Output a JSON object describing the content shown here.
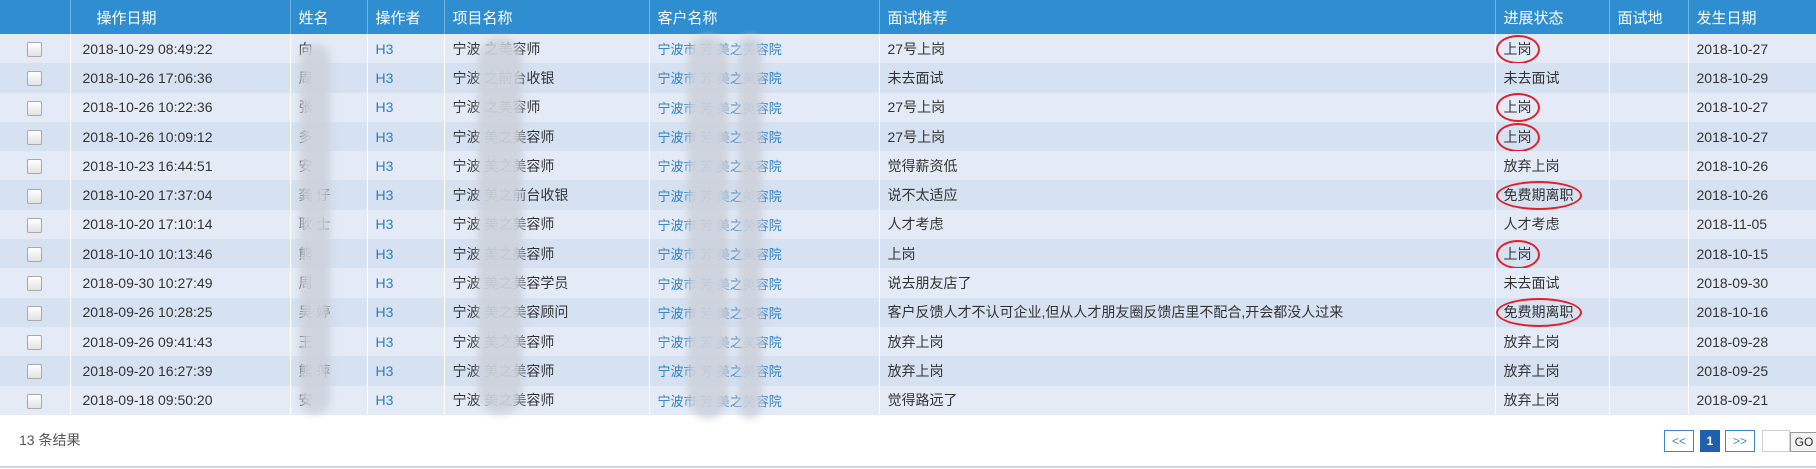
{
  "columns": [
    "",
    "操作日期",
    "姓名",
    "操作者",
    "项目名称",
    "客户名称",
    "面试推荐",
    "进展状态",
    "面试地",
    "发生日期"
  ],
  "rows": [
    {
      "date": "2018-10-29 08:49:22",
      "name": "向",
      "operator": "H3",
      "project": "宁波   之美容师",
      "customer": "宁波市  芳  美之美容院",
      "remark": "27号上岗",
      "status": "上岗",
      "circled": true,
      "place": "",
      "occur": "2018-10-27"
    },
    {
      "date": "2018-10-26 17:06:36",
      "name": "周",
      "operator": "H3",
      "project": "宁波   之前台收银",
      "customer": "宁波市  芳  美之美容院",
      "remark": "未去面试",
      "status": "未去面试",
      "circled": false,
      "place": "",
      "occur": "2018-10-29"
    },
    {
      "date": "2018-10-26 10:22:36",
      "name": "张  ",
      "operator": "H3",
      "project": "宁波   之美容师",
      "customer": "宁波市  芳  美之美容院",
      "remark": "27号上岗",
      "status": "上岗",
      "circled": true,
      "place": "",
      "occur": "2018-10-27"
    },
    {
      "date": "2018-10-26 10:09:12",
      "name": "多",
      "operator": "H3",
      "project": "宁波   美之美容师",
      "customer": "宁波市  芳  美之美容院",
      "remark": "27号上岗",
      "status": "上岗",
      "circled": true,
      "place": "",
      "occur": "2018-10-27"
    },
    {
      "date": "2018-10-23 16:44:51",
      "name": "安",
      "operator": "H3",
      "project": "宁波   美之美容师",
      "customer": "宁波市  芳  美之美容院",
      "remark": "觉得薪资低",
      "status": "放弃上岗",
      "circled": false,
      "place": "",
      "occur": "2018-10-26"
    },
    {
      "date": "2018-10-20 17:37:04",
      "name": "龚  仔",
      "operator": "H3",
      "project": "宁波   美之前台收银",
      "customer": "宁波市  芳  美之美容院",
      "remark": "说不太适应",
      "status": "免费期离职",
      "circled": true,
      "place": "",
      "occur": "2018-10-26"
    },
    {
      "date": "2018-10-20 17:10:14",
      "name": "耿  士",
      "operator": "H3",
      "project": "宁波   美之美容师",
      "customer": "宁波市  芳  美之美容院",
      "remark": "人才考虑",
      "status": "人才考虑",
      "circled": false,
      "place": "",
      "occur": "2018-11-05"
    },
    {
      "date": "2018-10-10 10:13:46",
      "name": "熊",
      "operator": "H3",
      "project": "宁波   美之美容师",
      "customer": "宁波市  芳  美之美容院",
      "remark": "上岗",
      "status": "上岗",
      "circled": true,
      "place": "",
      "occur": "2018-10-15"
    },
    {
      "date": "2018-09-30 10:27:49",
      "name": "周",
      "operator": "H3",
      "project": "宁波   美之美容学员",
      "customer": "宁波市  芳  美之美容院",
      "remark": "说去朋友店了",
      "status": "未去面试",
      "circled": false,
      "place": "",
      "occur": "2018-09-30"
    },
    {
      "date": "2018-09-26 10:28:25",
      "name": "吴  婷",
      "operator": "H3",
      "project": "宁波   美之美容顾问",
      "customer": "宁波市  芳  美之美容院",
      "remark": "客户反馈人才不认可企业,但从人才朋友圈反馈店里不配合,开会都没人过来",
      "status": "免费期离职",
      "circled": true,
      "place": "",
      "occur": "2018-10-16"
    },
    {
      "date": "2018-09-26 09:41:43",
      "name": "王",
      "operator": "H3",
      "project": "宁波   美之美容师",
      "customer": "宁波市  芳  美之美容院",
      "remark": "放弃上岗",
      "status": "放弃上岗",
      "circled": false,
      "place": "",
      "occur": "2018-09-28"
    },
    {
      "date": "2018-09-20 16:27:39",
      "name": "熊  萍",
      "operator": "H3",
      "project": "宁波   美之美容师",
      "customer": "宁波市  芳  美之美容院",
      "remark": "放弃上岗",
      "status": "放弃上岗",
      "circled": false,
      "place": "",
      "occur": "2018-09-25"
    },
    {
      "date": "2018-09-18 09:50:20",
      "name": "安",
      "operator": "H3",
      "project": "宁波   美之美容师",
      "customer": "宁波市  芳  美之美容院",
      "remark": "觉得路远了",
      "status": "放弃上岗",
      "circled": false,
      "place": "",
      "occur": "2018-09-21"
    }
  ],
  "footer": {
    "result_count": "13 条结果"
  },
  "pager": {
    "prev": "<<",
    "current": "1",
    "next": ">>",
    "go": "GO"
  },
  "colors": {
    "header_bg": "#2f8ecf",
    "row_odd": "#e4ebf6",
    "row_even": "#d6e1f1",
    "link": "#2b7fc4",
    "circle": "#e0202a"
  }
}
